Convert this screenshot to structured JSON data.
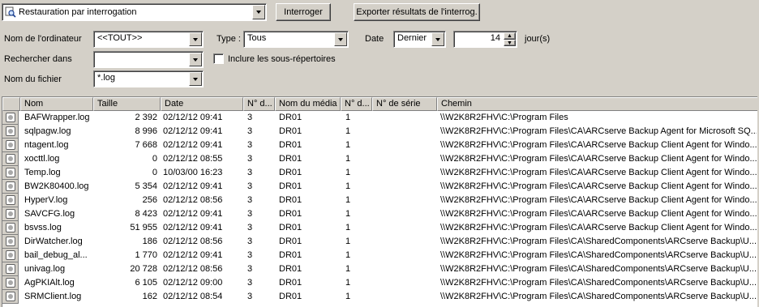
{
  "query": {
    "mode_value": "Restauration par interrogation",
    "interroger_label": "Interroger",
    "export_label": "Exporter résultats de l'interrog."
  },
  "filters": {
    "computer_label": "Nom de l'ordinateur",
    "computer_value": "<<TOUT>>",
    "type_label": "Type :",
    "type_value": "Tous",
    "date_label": "Date",
    "date_value": "Dernier",
    "days_value": "14",
    "days_unit": "jour(s)",
    "search_in_label": "Rechercher dans",
    "search_in_value": "",
    "include_sub_label": "Inclure les sous-répertoires",
    "filename_label": "Nom du fichier",
    "filename_value": "*.log"
  },
  "table": {
    "columns": [
      "Nom",
      "Taille",
      "Date",
      "N° d...",
      "Nom du média",
      "N° d...",
      "N° de série",
      "Chemin"
    ],
    "rows": [
      [
        "BAFWrapper.log",
        "2 392",
        "02/12/12 09:41",
        "3",
        "DR01",
        "1",
        "",
        "\\\\W2K8R2FHV\\C:\\Program Files"
      ],
      [
        "sqlpagw.log",
        "8 996",
        "02/12/12 09:41",
        "3",
        "DR01",
        "1",
        "",
        "\\\\W2K8R2FHV\\C:\\Program Files\\CA\\ARCserve Backup Agent for Microsoft SQ..."
      ],
      [
        "ntagent.log",
        "7 668",
        "02/12/12 09:41",
        "3",
        "DR01",
        "1",
        "",
        "\\\\W2K8R2FHV\\C:\\Program Files\\CA\\ARCserve Backup Client Agent for Windo..."
      ],
      [
        "xocttl.log",
        "0",
        "02/12/12 08:55",
        "3",
        "DR01",
        "1",
        "",
        "\\\\W2K8R2FHV\\C:\\Program Files\\CA\\ARCserve Backup Client Agent for Windo..."
      ],
      [
        "Temp.log",
        "0",
        "10/03/00 16:23",
        "3",
        "DR01",
        "1",
        "",
        "\\\\W2K8R2FHV\\C:\\Program Files\\CA\\ARCserve Backup Client Agent for Windo..."
      ],
      [
        "BW2K80400.log",
        "5 354",
        "02/12/12 09:41",
        "3",
        "DR01",
        "1",
        "",
        "\\\\W2K8R2FHV\\C:\\Program Files\\CA\\ARCserve Backup Client Agent for Windo..."
      ],
      [
        "HyperV.log",
        "256",
        "02/12/12 08:56",
        "3",
        "DR01",
        "1",
        "",
        "\\\\W2K8R2FHV\\C:\\Program Files\\CA\\ARCserve Backup Client Agent for Windo..."
      ],
      [
        "SAVCFG.log",
        "8 423",
        "02/12/12 09:41",
        "3",
        "DR01",
        "1",
        "",
        "\\\\W2K8R2FHV\\C:\\Program Files\\CA\\ARCserve Backup Client Agent for Windo..."
      ],
      [
        "bsvss.log",
        "51 955",
        "02/12/12 09:41",
        "3",
        "DR01",
        "1",
        "",
        "\\\\W2K8R2FHV\\C:\\Program Files\\CA\\ARCserve Backup Client Agent for Windo..."
      ],
      [
        "DirWatcher.log",
        "186",
        "02/12/12 08:56",
        "3",
        "DR01",
        "1",
        "",
        "\\\\W2K8R2FHV\\C:\\Program Files\\CA\\SharedComponents\\ARCserve Backup\\U..."
      ],
      [
        "bail_debug_al...",
        "1 770",
        "02/12/12 09:41",
        "3",
        "DR01",
        "1",
        "",
        "\\\\W2K8R2FHV\\C:\\Program Files\\CA\\SharedComponents\\ARCserve Backup\\U..."
      ],
      [
        "univag.log",
        "20 728",
        "02/12/12 08:56",
        "3",
        "DR01",
        "1",
        "",
        "\\\\W2K8R2FHV\\C:\\Program Files\\CA\\SharedComponents\\ARCserve Backup\\U..."
      ],
      [
        "AgPKIAlt.log",
        "6 105",
        "02/12/12 09:00",
        "3",
        "DR01",
        "1",
        "",
        "\\\\W2K8R2FHV\\C:\\Program Files\\CA\\SharedComponents\\ARCserve Backup\\U..."
      ],
      [
        "SRMClient.log",
        "162",
        "02/12/12 08:54",
        "3",
        "DR01",
        "1",
        "",
        "\\\\W2K8R2FHV\\C:\\Program Files\\CA\\SharedComponents\\ARCserve Backup\\U..."
      ]
    ]
  }
}
